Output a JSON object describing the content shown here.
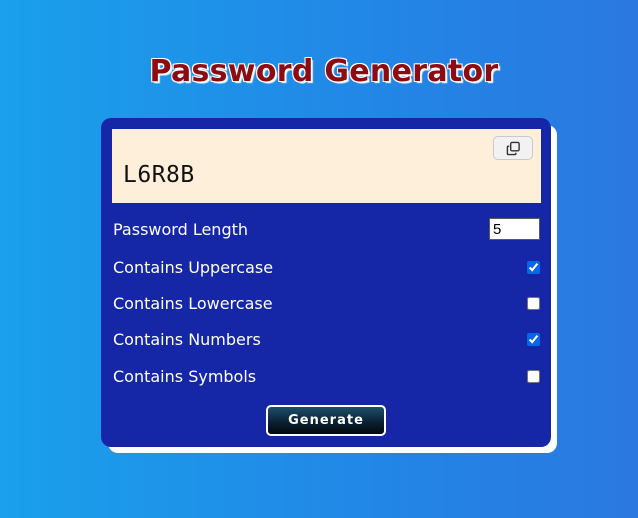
{
  "title": "Password Generator",
  "result": {
    "password": "L6R8B",
    "copy_icon": "copy-icon"
  },
  "settings": {
    "length_label": "Password Length",
    "length_value": "5",
    "uppercase_label": "Contains Uppercase",
    "uppercase_checked": true,
    "lowercase_label": "Contains Lowercase",
    "lowercase_checked": false,
    "numbers_label": "Contains Numbers",
    "numbers_checked": true,
    "symbols_label": "Contains Symbols",
    "symbols_checked": false
  },
  "generate_label": "Generate",
  "colors": {
    "title": "#8d0c14",
    "card": "#1526a6",
    "result_bg": "#feefdb",
    "checkbox_accent": "#0a66e8"
  }
}
